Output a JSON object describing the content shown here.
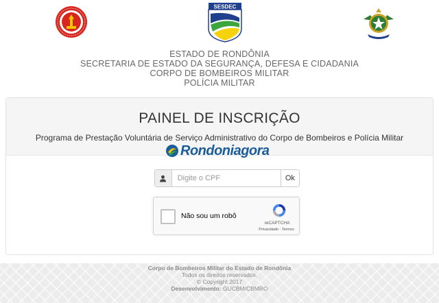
{
  "logos": {
    "cbm": {
      "icon": "fire-department-badge-icon",
      "color": "#d8261f"
    },
    "sesdec": {
      "icon": "sesdec-shield-icon",
      "label": "SESDEC"
    },
    "pm": {
      "icon": "military-police-crest-icon"
    }
  },
  "organization": {
    "line1": "ESTADO DE RONDÔNIA",
    "line2": "SECRETARIA DE ESTADO DA SEGURANÇA, DEFESA E CIDADANIA",
    "line3": "CORPO DE BOMBEIROS MILITAR",
    "line4": "POLÍCIA MILITAR"
  },
  "panel": {
    "title": "PAINEL DE INSCRIÇÃO",
    "subtitle": "Programa de Prestação Voluntária de Serviço Administrativo do Corpo de Bombeiros e Polícia Militar"
  },
  "watermark": {
    "text": "Rondoniagora",
    "color": "#1a5d9a"
  },
  "cpf_form": {
    "addon_icon": "user-icon",
    "placeholder": "Digite o CPF",
    "value": "",
    "submit_label": "Ok"
  },
  "recaptcha": {
    "label": "Não sou um robô",
    "brand": "reCAPTCHA",
    "links": "Privacidade - Termos",
    "icon": "recaptcha-logo-icon"
  },
  "footer": {
    "line1": "Corpo de Bombeiros Militar do Estado de Rondônia",
    "line2": "Todos os direitos reservados.",
    "line3": "© Copyright 2017",
    "dev_label": "Desenvolvimento:",
    "dev_value": "GUCBM/CBMRO"
  }
}
